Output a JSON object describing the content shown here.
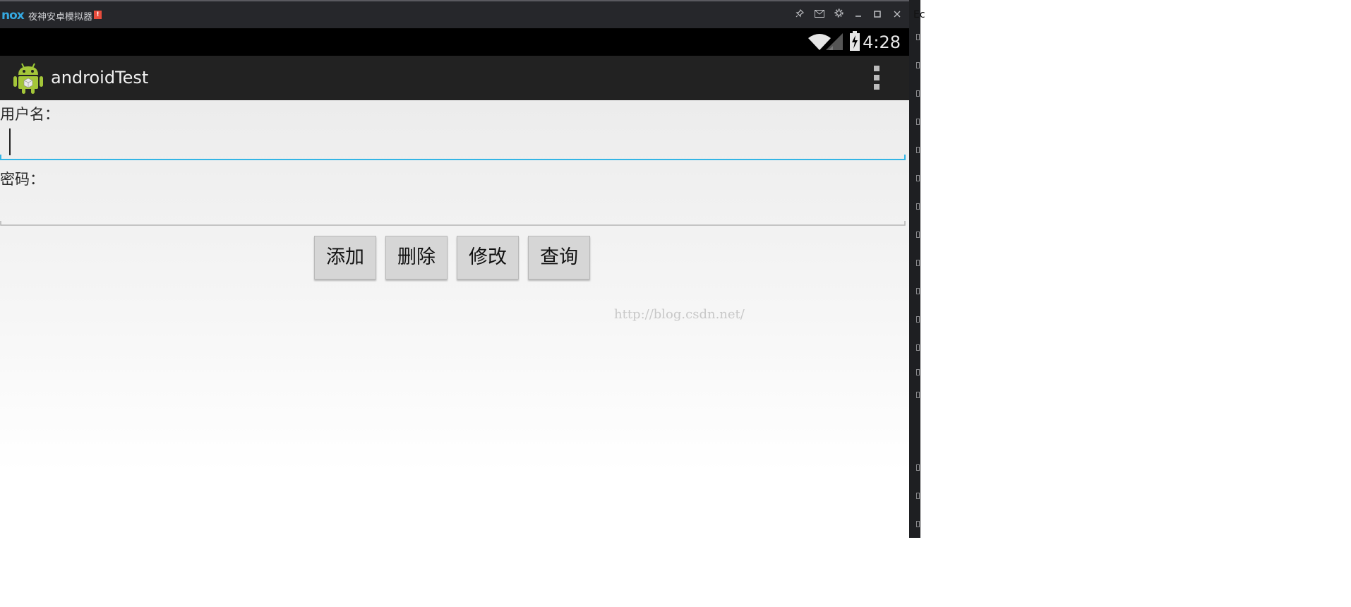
{
  "emulator": {
    "logo": "nox",
    "title": "夜神安卓模拟器",
    "badge": "!",
    "controls": [
      "pin-icon",
      "mail-icon",
      "gear-icon",
      "minimize-icon",
      "maximize-icon",
      "close-icon"
    ]
  },
  "statusbar": {
    "time": "4:28",
    "icons": [
      "wifi-icon",
      "signal-icon",
      "battery-charging-icon"
    ]
  },
  "actionbar": {
    "title": "androidTest",
    "menu": "overflow-menu-icon"
  },
  "form": {
    "username_label": "用户名：",
    "username_value": "",
    "password_label": "密码：",
    "password_value": ""
  },
  "buttons": {
    "add": "添加",
    "delete": "删除",
    "update": "修改",
    "query": "查询"
  },
  "watermark": "http://blog.csdn.net/",
  "edge_text": "Ec",
  "colors": {
    "accent": "#33b5e5",
    "actionbar": "#222222",
    "titlebar": "#26272b"
  }
}
